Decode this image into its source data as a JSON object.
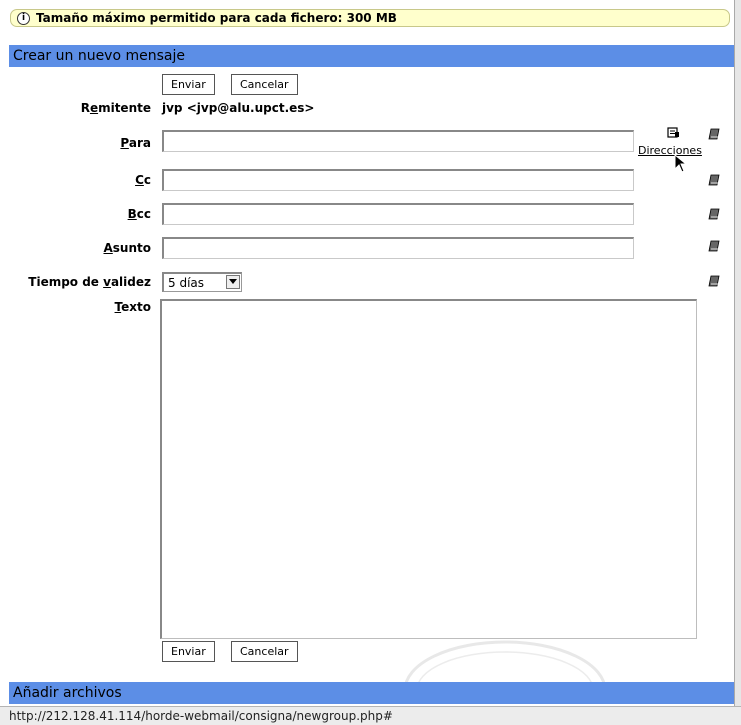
{
  "notice": {
    "text": "Tamaño máximo permitido para cada fichero: 300 MB",
    "icon": "info-icon"
  },
  "compose": {
    "title": "Crear un nuevo mensaje",
    "send_label": "Enviar",
    "cancel_label": "Cancelar",
    "sender": {
      "label_pre": "R",
      "label_ul": "e",
      "label_post": "mitente",
      "value": "jvp <jvp@alu.upct.es>"
    },
    "to": {
      "label_ul": "P",
      "label_post": "ara",
      "value": ""
    },
    "cc": {
      "label_ul": "C",
      "label_post": "c",
      "value": ""
    },
    "bcc": {
      "label_ul": "B",
      "label_post": "cc",
      "value": ""
    },
    "subject": {
      "label_ul": "A",
      "label_post": "sunto",
      "value": ""
    },
    "validity": {
      "label_pre": "Tiempo de ",
      "label_ul": "v",
      "label_post": "alidez",
      "selected": "5 días"
    },
    "body": {
      "label_ul": "T",
      "label_post": "exto",
      "value": ""
    },
    "addressbook_label": "Direcciones"
  },
  "attachments": {
    "title": "Añadir archivos"
  },
  "statusbar": {
    "url": "http://212.128.41.114/horde-webmail/consigna/newgroup.php#"
  },
  "colors": {
    "header": "#5c8ee6",
    "notice_bg": "#ffffcc"
  }
}
